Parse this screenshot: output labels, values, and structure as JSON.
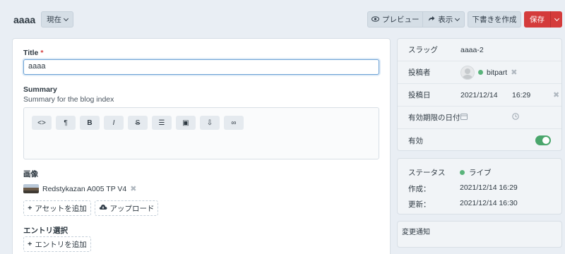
{
  "header": {
    "entry_title": "aaaa",
    "site_selector": "現在",
    "preview_label": "プレビュー",
    "visit_label": "表示",
    "draft_label": "下書きを作成",
    "save_label": "保存"
  },
  "form": {
    "title_label": "Title",
    "required_mark": "*",
    "title_value": "aaaa",
    "summary_label": "Summary",
    "summary_help": "Summary for the blog index",
    "toolbar": [
      {
        "icon": "code-icon",
        "glyph": "<>"
      },
      {
        "icon": "paragraph-icon",
        "glyph": "¶"
      },
      {
        "icon": "bold-icon",
        "glyph": "B"
      },
      {
        "icon": "italic-icon",
        "glyph": "I"
      },
      {
        "icon": "strikethrough-icon",
        "glyph": "S"
      },
      {
        "icon": "list-icon",
        "glyph": "☰"
      },
      {
        "icon": "image-icon",
        "glyph": "▣"
      },
      {
        "icon": "embed-icon",
        "glyph": "⇩"
      },
      {
        "icon": "link-icon",
        "glyph": "∞"
      }
    ],
    "image_label": "画像",
    "asset_name": "Redstykazan A005 TP V4",
    "add_asset_label": "アセットを追加",
    "upload_label": "アップロード",
    "entries_label": "エントリ選択",
    "add_entry_label": "エントリを追加"
  },
  "sidebar": {
    "slug_key": "スラッグ",
    "slug_value": "aaaa-2",
    "author_key": "投稿者",
    "author_value": "bitpart",
    "date_key": "投稿日",
    "date_value": "2021/12/14",
    "time_value": "16:29",
    "expiry_key": "有効期限の日付",
    "enabled_key": "有効"
  },
  "meta": {
    "status_key": "ステータス",
    "status_value": "ライブ",
    "created_key": "作成：",
    "created_value": "2021/12/14 16:29",
    "updated_key": "更新：",
    "updated_value": "2021/12/14 16:30"
  },
  "notes": {
    "label": "変更通知"
  },
  "colors": {
    "accent": "#d43b3b",
    "live": "#5ab47b",
    "toggle_on": "#4aa66c",
    "focus": "#6aa0d4"
  }
}
